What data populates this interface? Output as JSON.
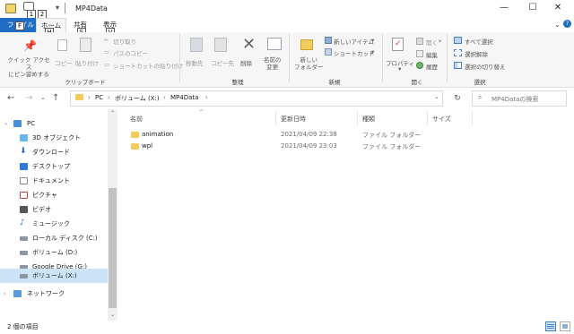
{
  "window": {
    "title": "MP4Data"
  },
  "keytips": {
    "qat1": "1",
    "qat2": "2",
    "file": "F",
    "home": "H",
    "share": "S",
    "view": "V"
  },
  "tabs": {
    "file": "ファイル",
    "home": "ホーム",
    "share": "共有",
    "view": "表示"
  },
  "ribbon": {
    "clipboard": {
      "pin": "クイック アクセス\nにピン留めする",
      "copy": "コピー",
      "paste": "貼り付け",
      "cut": "切り取り",
      "copy_path": "パスのコピー",
      "paste_shortcut": "ショートカットの貼り付け",
      "group": "クリップボード"
    },
    "organize": {
      "move_to": "移動先",
      "copy_to": "コピー先",
      "delete": "削除",
      "rename": "名前の\n変更",
      "group": "整理"
    },
    "new": {
      "new_folder": "新しい\nフォルダー",
      "new_item": "新しいアイテム",
      "shortcut": "ショートカット",
      "group": "新規"
    },
    "open": {
      "properties": "プロパティ",
      "open": "開く",
      "edit": "編集",
      "history": "履歴",
      "group": "開く"
    },
    "select": {
      "select_all": "すべて選択",
      "select_none": "選択解除",
      "invert": "選択の切り替え",
      "group": "選択"
    }
  },
  "address": {
    "crumbs": [
      "PC",
      "ボリューム (X:)",
      "MP4Data"
    ],
    "search_placeholder": "MP4Dataの検索"
  },
  "nav": {
    "items": [
      {
        "label": "PC",
        "icon": "pc-icon"
      },
      {
        "label": "3D オブジェクト",
        "icon": "3d-objects-icon"
      },
      {
        "label": "ダウンロード",
        "icon": "download-icon"
      },
      {
        "label": "デスクトップ",
        "icon": "desktop-icon"
      },
      {
        "label": "ドキュメント",
        "icon": "documents-icon"
      },
      {
        "label": "ピクチャ",
        "icon": "pictures-icon"
      },
      {
        "label": "ビデオ",
        "icon": "videos-icon"
      },
      {
        "label": "ミュージック",
        "icon": "music-icon"
      },
      {
        "label": "ローカル ディスク (C:)",
        "icon": "drive-icon"
      },
      {
        "label": "ボリューム (D:)",
        "icon": "drive-icon"
      },
      {
        "label": "Google Drive (G:)",
        "icon": "drive-icon"
      },
      {
        "label": "ボリューム (X:)",
        "icon": "drive-icon"
      },
      {
        "label": "ネットワーク",
        "icon": "network-icon"
      }
    ]
  },
  "list": {
    "columns": [
      "名前",
      "更新日時",
      "種類",
      "サイズ"
    ],
    "rows": [
      {
        "name": "animation",
        "modified": "2021/04/09 22:38",
        "type": "ファイル フォルダー",
        "size": ""
      },
      {
        "name": "wpl",
        "modified": "2021/04/09 23:03",
        "type": "ファイル フォルダー",
        "size": ""
      }
    ]
  },
  "status": {
    "text": "2 個の項目"
  },
  "colors": {
    "accent": "#1e6fc4",
    "selection": "#cce4f7",
    "folder": "#f2cd5c"
  }
}
